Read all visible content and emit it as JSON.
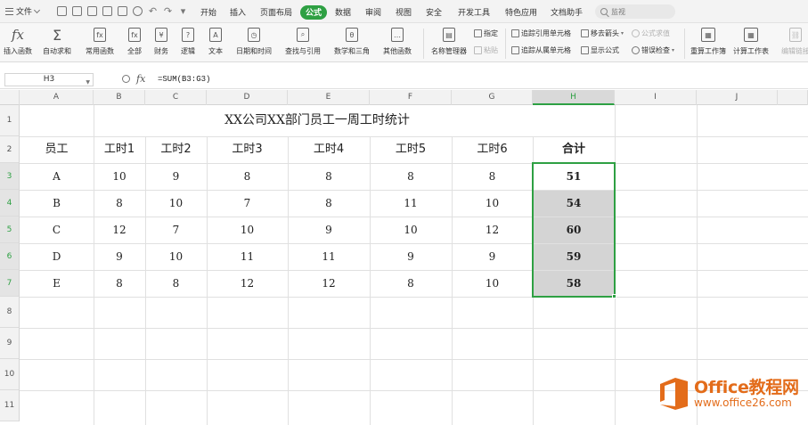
{
  "menubar": {
    "file_label": "文件",
    "tabs": [
      "开始",
      "插入",
      "页面布局",
      "公式",
      "数据",
      "审阅",
      "视图",
      "安全",
      "开发工具",
      "特色应用",
      "文档助手"
    ],
    "active_tab": "公式",
    "search_placeholder": "监视"
  },
  "ribbon": {
    "buttons": [
      {
        "icon": "fx-icon",
        "label": "插入函数"
      },
      {
        "icon": "sigma-icon",
        "label": "自动求和"
      },
      {
        "icon": "common-function-icon",
        "label": "常用函数"
      },
      {
        "icon": "all-function-icon",
        "label": "全部"
      },
      {
        "icon": "finance-icon",
        "label": "财务"
      },
      {
        "icon": "logic-icon",
        "label": "逻辑"
      },
      {
        "icon": "text-icon",
        "label": "文本"
      },
      {
        "icon": "datetime-icon",
        "label": "日期和时间"
      },
      {
        "icon": "lookup-icon",
        "label": "查找与引用"
      },
      {
        "icon": "math-icon",
        "label": "数学和三角"
      },
      {
        "icon": "other-function-icon",
        "label": "其他函数"
      },
      {
        "icon": "name-manager-icon",
        "label": "名称管理器"
      }
    ],
    "small": {
      "specify": "指定",
      "paste": "粘贴",
      "trace_precedents": "追踪引用单元格",
      "trace_dependents": "追踪从属单元格",
      "remove_arrows": "移去箭头",
      "show_formulas": "显示公式",
      "evaluate": "公式求值",
      "error_check": "错误检查"
    },
    "recalc_workbook": "重算工作簿",
    "calc_sheet": "计算工作表",
    "edit_links": "编辑链接"
  },
  "formula_bar": {
    "cell_ref": "H3",
    "fx": "fx",
    "formula": "=SUM(B3:G3)"
  },
  "sheet": {
    "columns": [
      "A",
      "B",
      "C",
      "D",
      "E",
      "F",
      "G",
      "H",
      "I",
      "J"
    ],
    "rows": [
      "1",
      "2",
      "3",
      "4",
      "5",
      "6",
      "7",
      "8",
      "9",
      "10",
      "11"
    ],
    "title": "XX公司XX部门员工一周工时统计",
    "headers": [
      "员工",
      "工时1",
      "工时2",
      "工时3",
      "工时4",
      "工时5",
      "工时6",
      "合计"
    ],
    "data": [
      [
        "A",
        "10",
        "9",
        "8",
        "8",
        "8",
        "8",
        "51"
      ],
      [
        "B",
        "8",
        "10",
        "7",
        "8",
        "11",
        "10",
        "54"
      ],
      [
        "C",
        "12",
        "7",
        "10",
        "9",
        "10",
        "12",
        "60"
      ],
      [
        "D",
        "9",
        "10",
        "11",
        "11",
        "9",
        "9",
        "59"
      ],
      [
        "E",
        "8",
        "8",
        "12",
        "12",
        "8",
        "10",
        "58"
      ]
    ],
    "selected_column": "H",
    "selection_color": "#2ea043"
  },
  "watermark": {
    "line1": "Office教程网",
    "line2": "www.office26.com"
  }
}
